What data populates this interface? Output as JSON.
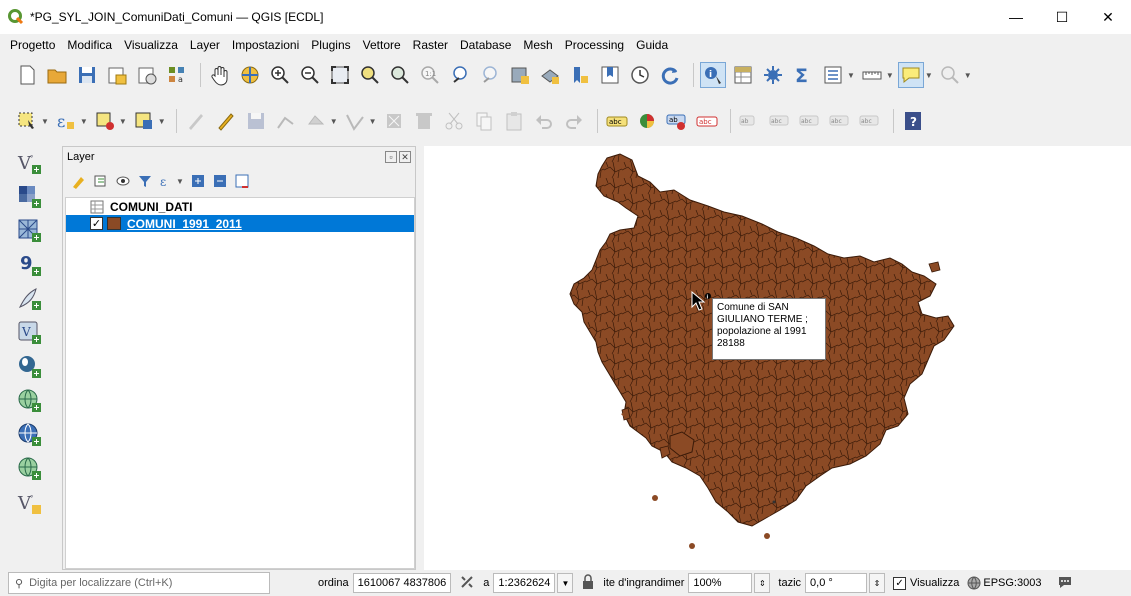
{
  "window": {
    "title": "*PG_SYL_JOIN_ComuniDati_Comuni — QGIS [ECDL]",
    "minimize": "—",
    "maximize": "☐",
    "close": "✕"
  },
  "menu": [
    "Progetto",
    "Modifica",
    "Visualizza",
    "Layer",
    "Impostazioni",
    "Plugins",
    "Vettore",
    "Raster",
    "Database",
    "Mesh",
    "Processing",
    "Guida"
  ],
  "layer_panel": {
    "title": "Layer",
    "layers": [
      {
        "name": "COMUNI_DATI",
        "type": "table",
        "checked": null,
        "selected": false
      },
      {
        "name": "COMUNI_1991_2011",
        "type": "polygon",
        "checked": true,
        "selected": true,
        "color": "#8b4a25"
      }
    ]
  },
  "map": {
    "fill_color": "#8b4a25",
    "tooltip": {
      "line1": "Comune di SAN",
      "line2": "GIULIANO TERME ;",
      "line3": "popolazione al 1991",
      "line4": "28188"
    }
  },
  "status": {
    "search_placeholder": "Digita per localizzare (Ctrl+K)",
    "coord_label": "ordina",
    "coord_value": "1610067 4837806",
    "scale_label": "a",
    "scale_value": "1:2362624",
    "magnifier_label": "ite d'ingrandimer",
    "magnifier_value": "100%",
    "rotation_label": "tazic",
    "rotation_value": "0,0 °",
    "render_label": "Visualizza",
    "crs": "EPSG:3003"
  }
}
